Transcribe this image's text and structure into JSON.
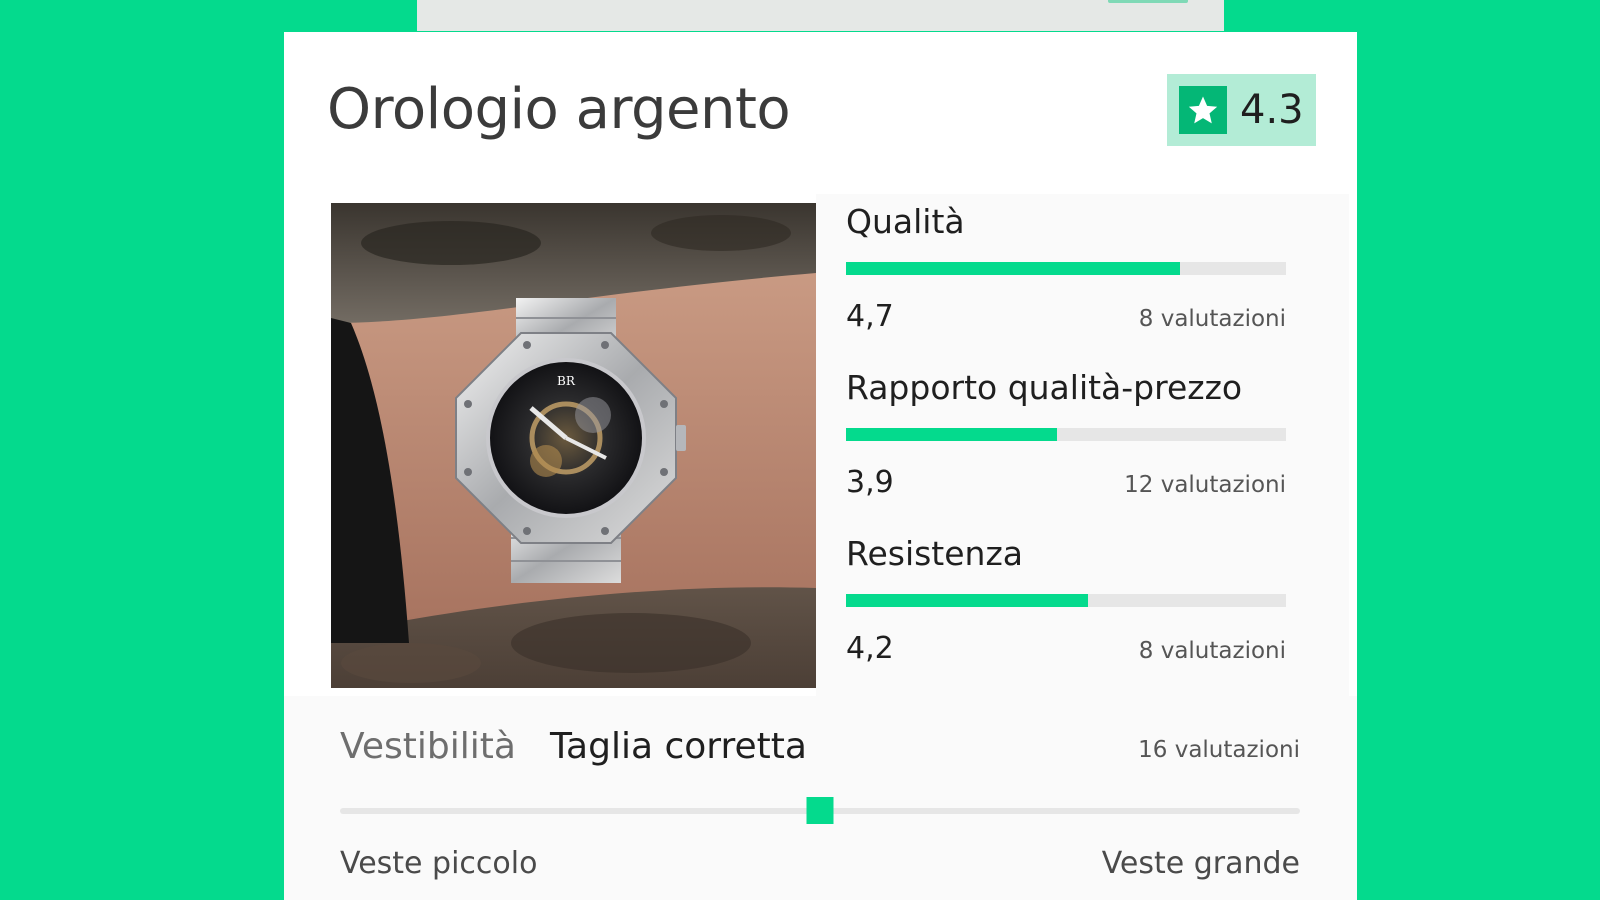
{
  "product": {
    "title": "Orologio argento",
    "overall_rating": "4.3",
    "photo_icon": "wristwatch-photo"
  },
  "metrics": [
    {
      "name": "Qualità",
      "score": "4,7",
      "count": "8 valutazioni",
      "fill_fraction": 0.76
    },
    {
      "name": "Rapporto qualità-prezzo",
      "score": "3,9",
      "count": "12 valutazioni",
      "fill_fraction": 0.48
    },
    {
      "name": "Resistenza",
      "score": "4,2",
      "count": "8 valutazioni",
      "fill_fraction": 0.55
    }
  ],
  "fit": {
    "label": "Vestibilità",
    "value": "Taglia corretta",
    "count": "16 valutazioni",
    "position_fraction": 0.5,
    "low_label": "Veste piccolo",
    "high_label": "Veste grande"
  },
  "colors": {
    "brand_green": "#04da8d",
    "badge_bg": "#b3ecd6",
    "star_bg": "#04b776",
    "track": "#e6e6e6"
  },
  "icons": {
    "star": "star-icon"
  }
}
